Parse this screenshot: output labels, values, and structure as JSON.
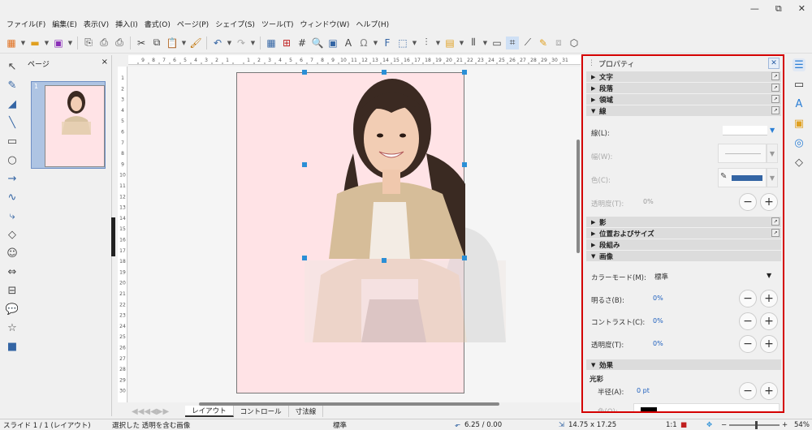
{
  "menubar": [
    "ファイル(F)",
    "編集(E)",
    "表示(V)",
    "挿入(I)",
    "書式(O)",
    "ページ(P)",
    "シェイプ(S)",
    "ツール(T)",
    "ウィンドウ(W)",
    "ヘルプ(H)"
  ],
  "window_controls": {
    "minimize": "—",
    "restore": "⧉",
    "close": "✕"
  },
  "pages_panel": {
    "title": "ページ",
    "close": "×",
    "thumb_number": "1"
  },
  "ruler": {
    "h_ticks": [
      "9",
      "8",
      "7",
      "6",
      "5",
      "4",
      "3",
      "2",
      "1",
      "",
      "1",
      "2",
      "3",
      "4",
      "5",
      "6",
      "7",
      "8",
      "9",
      "10",
      "11",
      "12",
      "13",
      "14",
      "15",
      "16",
      "17",
      "18",
      "19",
      "20",
      "21",
      "22",
      "23",
      "24",
      "25",
      "26",
      "27",
      "28",
      "29",
      "30",
      "31"
    ],
    "v_ticks": [
      "1",
      "2",
      "3",
      "4",
      "5",
      "6",
      "7",
      "8",
      "9",
      "10",
      "11",
      "12",
      "13",
      "14",
      "15",
      "16",
      "17",
      "18",
      "19",
      "20",
      "21",
      "22",
      "23",
      "24",
      "25",
      "26",
      "27",
      "28",
      "29",
      "30"
    ]
  },
  "tabs": {
    "nav": "◀◀◀◀▶▶",
    "items": [
      "レイアウト",
      "コントロール",
      "寸法線"
    ]
  },
  "status": {
    "slide": "スライド 1 / 1 (レイアウト)",
    "selection": "選択した 透明を含む画像",
    "layout": "標準",
    "position": "6.25 / 0.00",
    "size": "14.75 x 17.25",
    "ratio": "1:1",
    "zoom_minus": "−",
    "zoom_plus": "+",
    "zoom": "54%",
    "zoom_level": 0.54
  },
  "sidebar": {
    "title": "プロパティ",
    "close": "✕",
    "sections_top": [
      "文字",
      "段落",
      "領域"
    ],
    "line_section": "線",
    "line_label": "線(L):",
    "width_label": "幅(W):",
    "color_label": "色(C):",
    "transparency_label": "透明度(T):",
    "transparency_value": "0%",
    "sections_mid": [
      "影",
      "位置およびサイズ",
      "段組み"
    ],
    "image_section": "画像",
    "color_mode_label": "カラーモード(M):",
    "color_mode_value": "標準",
    "brightness_label": "明るさ(B):",
    "brightness_value": "0%",
    "contrast_label": "コントラスト(C):",
    "contrast_value": "0%",
    "img_transparency_label": "透明度(T):",
    "img_transparency_value": "0%",
    "effects_section": "効果",
    "glow_label": "光彩",
    "radius_label": "半径(A):",
    "radius_value": "0 pt",
    "glow_color_label": "色(O):"
  },
  "colors": {
    "accent": "#2b8fd6",
    "highlight_border": "#d40000",
    "page_fill": "#ffe3e6",
    "line_color": "#3465a4"
  }
}
